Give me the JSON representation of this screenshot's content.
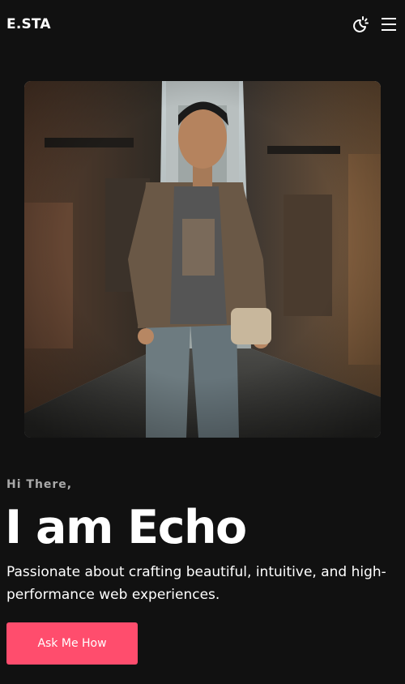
{
  "header": {
    "logo": "E.STA",
    "theme_toggle_icon": "theme-toggle-icon",
    "menu_icon": "hamburger-menu-icon"
  },
  "hero": {
    "photo_alt": "Portrait of a young man in a plaid shirt standing in a city alley",
    "greeting": "Hi There,",
    "headline": "I am Echo",
    "tagline": "Passionate about crafting beautiful, intuitive, and high-performance web experiences.",
    "cta_label": "Ask Me How"
  },
  "colors": {
    "background": "#111111",
    "accent": "#ff4d6d",
    "muted_text": "#a9a9a9"
  }
}
